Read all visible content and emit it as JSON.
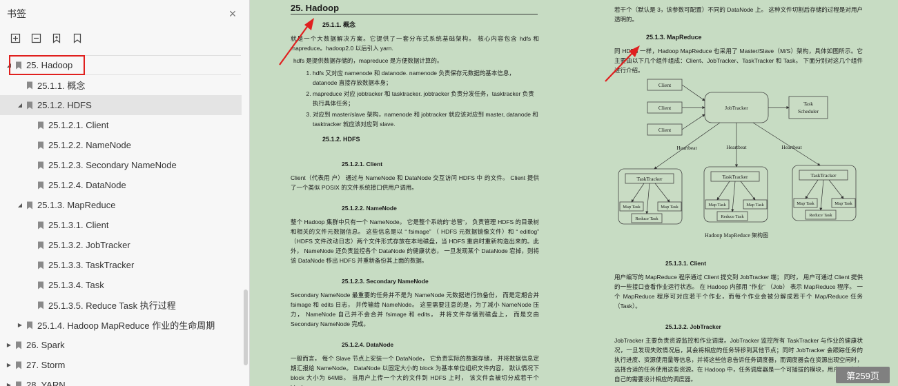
{
  "sidebar": {
    "title": "书签",
    "close": "×",
    "toolbar": [
      {
        "name": "expand-all-icon"
      },
      {
        "name": "collapse-all-icon"
      },
      {
        "name": "add-bookmark-icon"
      },
      {
        "name": "bookmark-icon"
      }
    ],
    "items": [
      {
        "label": "25. Hadoop",
        "level": 0,
        "caret": "down"
      },
      {
        "label": "25.1.1. 概念",
        "level": 1,
        "caret": "none"
      },
      {
        "label": "25.1.2. HDFS",
        "level": 1,
        "caret": "down"
      },
      {
        "label": "25.1.2.1.  Client",
        "level": 2,
        "caret": "none"
      },
      {
        "label": "25.1.2.2.  NameNode",
        "level": 2,
        "caret": "none"
      },
      {
        "label": "25.1.2.3. Secondary NameNode",
        "level": 2,
        "caret": "none"
      },
      {
        "label": "25.1.2.4. DataNode",
        "level": 2,
        "caret": "none"
      },
      {
        "label": "25.1.3. MapReduce",
        "level": 1,
        "caret": "down"
      },
      {
        "label": "25.1.3.1.  Client",
        "level": 2,
        "caret": "none"
      },
      {
        "label": "25.1.3.2.  JobTracker",
        "level": 2,
        "caret": "none"
      },
      {
        "label": "25.1.3.3. TaskTracker",
        "level": 2,
        "caret": "none"
      },
      {
        "label": "25.1.3.4.  Task",
        "level": 2,
        "caret": "none"
      },
      {
        "label": "25.1.3.5. Reduce Task 执行过程",
        "level": 2,
        "caret": "none"
      },
      {
        "label": "25.1.4. Hadoop MapReduce 作业的生命周期",
        "level": 1,
        "caret": "right"
      },
      {
        "label": "26. Spark",
        "level": 0,
        "caret": "right"
      },
      {
        "label": "27. Storm",
        "level": 0,
        "caret": "right"
      },
      {
        "label": "28. YARN",
        "level": 0,
        "caret": "right"
      }
    ]
  },
  "left_page": {
    "chapter": "25.   Hadoop",
    "s_concept": "25.1.1.    概念",
    "p1": "就是一个大数据解决方案。它提供了一套分布式系统基础架构。 核心内容包含  hdfs  和 mapreduce。hadoop2.0 以后引入 yarn.",
    "p2": "hdfs 是提供数据存储的，mapreduce 是方便数据计算的。",
    "list": [
      "hdfs  又对应  namenode  和  datanode. namenode 负责保存元数据的基本信息， datanode 直接存放数据本身；",
      "mapreduce 对应 jobtracker 和 tasktracker. jobtracker 负责分发任务，tasktracker 负责执行具体任务；",
      "对应到 master/slave 架构，namenode 和 jobtracker 就应该对应到 master, datanode 和 tasktracker 就应该对应到 slave."
    ],
    "s_hdfs": "25.1.2.    HDFS",
    "s_client": "25.1.2.1.     Client",
    "p_client": "Client（代表用 户） 通过与 NameNode 和 DataNode 交互访问 HDFS 中 的文件。 Client 提供了一个类似 POSIX 的文件系统接口供用户调用。",
    "s_namenode": "25.1.2.2.     NameNode",
    "p_namenode": "整个 Hadoop 集群中只有一个 NameNode。 它是整个系统的“总管”， 负责管理 HDFS 的目录树和相关的文件元数据信息。 这些信息是以 “ fsimage” （ HDFS 元数据镜像文件）和 “ editlog” （HDFS 文件改动日志）两个文件形式存放在本地磁盘，当 HDFS 重启时重新构造出来的。此外， NameNode 还负责监控各个 DataNode 的健康状态， 一旦发现某个 DataNode 宕掉，则将该 DataNode 移出 HDFS 并重新备份其上面的数据。",
    "s_secondary": "25.1.2.3.    Secondary NameNode",
    "p_secondary": "Secondary NameNode 最重要的任务并不是为 NameNode 元数据进行热备份， 而是定期合并 fsimage 和 edits 日志， 并传输给 NameNode。 这里需要注意的是，为了减小 NameNode 压力， NameNode 自己并不会合并 fsimage 和 edits， 并将文件存储到磁盘上， 而是交由 Secondary NameNode 完成。",
    "s_datanode": "25.1.2.4.     DataNode",
    "p_datanode": "一般而言， 每个 Slave 节点上安装一个 DataNode， 它负责实际的数据存储， 并将数据信息定期汇报给 NameNode。 DataNode 以固定大小的 block 为基本单位组织文件内容， 默认情况下 block 大小为 64MB。 当用户上传一个大的文件到 HDFS 上时， 该文件会被切分成若干个 block，"
  },
  "right_page": {
    "p_top": "若干个（默认是 3，该参数可配置）不同的 DataNode 上。 这种文件切割后存储的过程是对用户透明的。",
    "s_mapreduce": "25.1.3.    MapReduce",
    "p_mr": "同 HDFS 一样，Hadoop MapReduce 也采用了 Master/Slave（M/S）架构，具体如图所示。它主要由以下几个组件组成：Client、JobTracker、TaskTracker 和 Task。 下面分别对这几个组件进行介绍。",
    "diagram": {
      "client": "Client",
      "jobtracker": "JobTracker",
      "scheduler_1": "Task",
      "scheduler_2": "Scheduler",
      "heartbeat": "Heartbeat",
      "tasktracker": "TaskTracker",
      "maptask": "Map Task",
      "reducetask": "Reduce Task",
      "caption": "Hadoop MapReduce 架构图"
    },
    "s_client": "25.1.3.1.     Client",
    "p_client": "用户编写的 MapReduce 程序通过 Client 提交到 JobTracker 端； 同时， 用户可通过 Client 提供的一些接口查看作业运行状态。 在 Hadoop 内部用 “作业” （Job） 表示 MapReduce 程序。 一个 MapReduce 程序可对应若干个作业，而每个作业会被分解成若干个 Map/Reduce 任务（Task）。",
    "s_jobtracker": "25.1.3.2.     JobTracker",
    "p_jobtracker": "JobTracker 主要负责资源监控和作业调度。JobTracker 监控所有 TaskTracker 与作业的健康状况，一旦发现失败情况后，其会将相应的任务转移到其他节点；同时 JobTracker 会跟踪任务的执行进度、资源使用量等信息，并将这些信息告诉任务调度器，而调度器会在资源出现空闲时，选择合适的任务使用这些资源。在 Hadoop 中，任务调度器是一个可插拔的模块，用户可以根据自己的需要设计相应的调度器。"
  },
  "page_indicator": "第259页",
  "colors": {
    "page_bg": "#c7dcc3",
    "sidebar_bg": "#f7f7f7",
    "highlight": "#e0201e",
    "arrow": "#e02020"
  }
}
